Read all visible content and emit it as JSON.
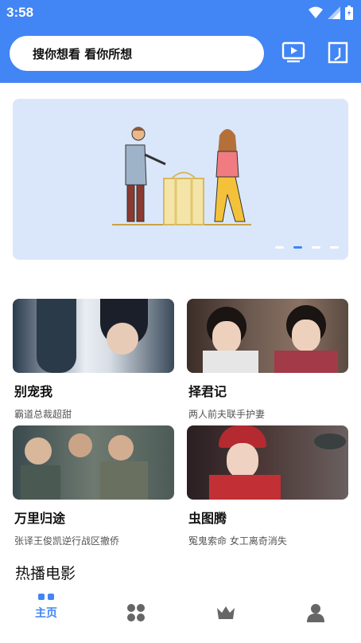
{
  "status": {
    "time": "3:58"
  },
  "search": {
    "placeholder": "搜你想看 看你所想"
  },
  "banner": {
    "dots": 4,
    "active_dot": 1
  },
  "cards": [
    {
      "title": "别宠我",
      "subtitle": "霸道总裁超甜"
    },
    {
      "title": "择君记",
      "subtitle": "两人前夫联手护妻"
    },
    {
      "title": "万里归途",
      "subtitle": "张译王俊凯逆行战区撤侨"
    },
    {
      "title": "虫图腾",
      "subtitle": "冤鬼索命 女工离奇消失"
    }
  ],
  "section": {
    "title": "热播电影"
  },
  "nav": {
    "home_label": "主页"
  },
  "colors": {
    "accent": "#4285f4",
    "banner_bg": "#dae7fb"
  }
}
